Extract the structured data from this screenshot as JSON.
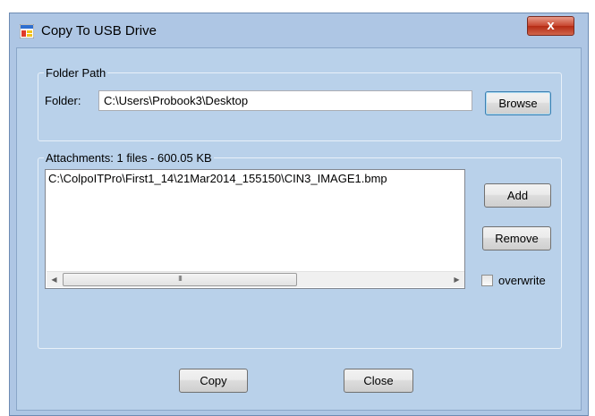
{
  "window": {
    "title": "Copy To USB Drive",
    "close_glyph": "x",
    "app_icon": "window-app-icon",
    "close_color": "#c7452e",
    "client_background": "#b9d1ea"
  },
  "folder_group": {
    "title": "Folder Path",
    "folder_label": "Folder:",
    "folder_value": "C:\\Users\\Probook3\\Desktop",
    "browse_label": "Browse"
  },
  "attachments_group": {
    "title": "Attachments: 1 files - 600.05 KB",
    "files": [
      "C:\\ColpoITPro\\First1_14\\21Mar2014_155150\\CIN3_IMAGE1.bmp"
    ],
    "scroll_left": "◀",
    "scroll_right": "▶",
    "scroll_grip": "III",
    "add_label": "Add",
    "remove_label": "Remove",
    "overwrite_label": "overwrite",
    "overwrite_checked": false
  },
  "footer": {
    "copy_label": "Copy",
    "close_label": "Close"
  }
}
